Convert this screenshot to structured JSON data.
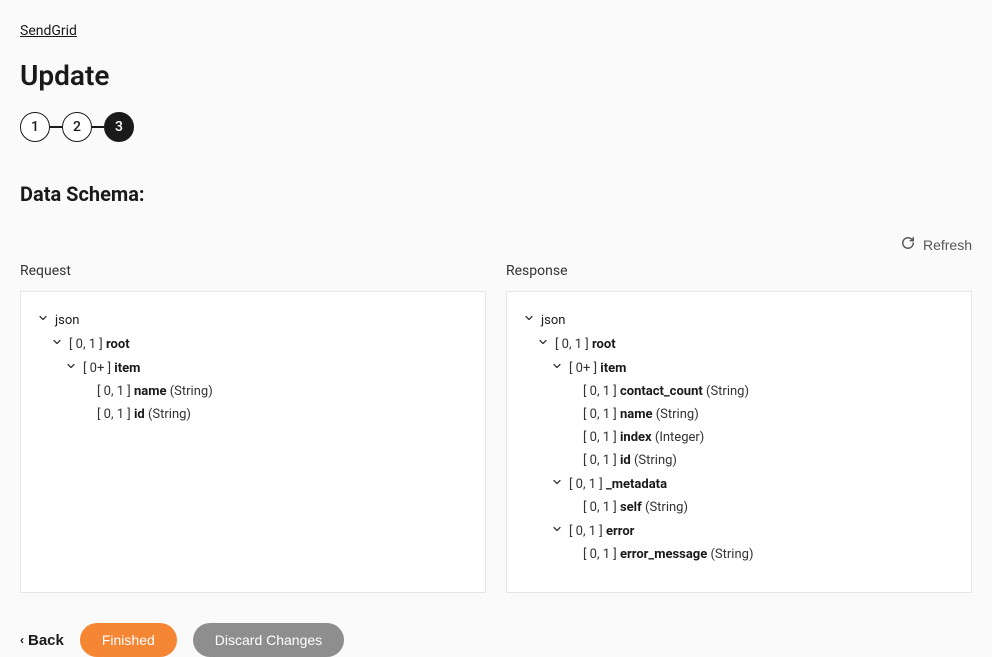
{
  "breadcrumb": "SendGrid",
  "page_title": "Update",
  "steps": {
    "items": [
      "1",
      "2",
      "3"
    ],
    "active_index": 2
  },
  "section_title": "Data Schema:",
  "refresh_label": "Refresh",
  "panels": {
    "request": {
      "label": "Request",
      "tree": [
        {
          "indent": 0,
          "expandable": true,
          "card": null,
          "name": "json",
          "type": null
        },
        {
          "indent": 1,
          "expandable": true,
          "card": "[ 0, 1 ]",
          "name": "root",
          "type": null
        },
        {
          "indent": 2,
          "expandable": true,
          "card": "[ 0+ ]",
          "name": "item",
          "type": null
        },
        {
          "indent": 3,
          "expandable": false,
          "card": "[ 0, 1 ]",
          "name": "name",
          "type": "(String)"
        },
        {
          "indent": 3,
          "expandable": false,
          "card": "[ 0, 1 ]",
          "name": "id",
          "type": "(String)"
        }
      ]
    },
    "response": {
      "label": "Response",
      "tree": [
        {
          "indent": 0,
          "expandable": true,
          "card": null,
          "name": "json",
          "type": null
        },
        {
          "indent": 1,
          "expandable": true,
          "card": "[ 0, 1 ]",
          "name": "root",
          "type": null
        },
        {
          "indent": 2,
          "expandable": true,
          "card": "[ 0+ ]",
          "name": "item",
          "type": null
        },
        {
          "indent": 3,
          "expandable": false,
          "card": "[ 0, 1 ]",
          "name": "contact_count",
          "type": "(String)"
        },
        {
          "indent": 3,
          "expandable": false,
          "card": "[ 0, 1 ]",
          "name": "name",
          "type": "(String)"
        },
        {
          "indent": 3,
          "expandable": false,
          "card": "[ 0, 1 ]",
          "name": "index",
          "type": "(Integer)"
        },
        {
          "indent": 3,
          "expandable": false,
          "card": "[ 0, 1 ]",
          "name": "id",
          "type": "(String)"
        },
        {
          "indent": 2,
          "expandable": true,
          "card": "[ 0, 1 ]",
          "name": "_metadata",
          "type": null
        },
        {
          "indent": 3,
          "expandable": false,
          "card": "[ 0, 1 ]",
          "name": "self",
          "type": "(String)"
        },
        {
          "indent": 2,
          "expandable": true,
          "card": "[ 0, 1 ]",
          "name": "error",
          "type": null
        },
        {
          "indent": 3,
          "expandable": false,
          "card": "[ 0, 1 ]",
          "name": "error_message",
          "type": "(String)"
        }
      ]
    }
  },
  "actions": {
    "back": "Back",
    "finished": "Finished",
    "discard": "Discard Changes"
  }
}
